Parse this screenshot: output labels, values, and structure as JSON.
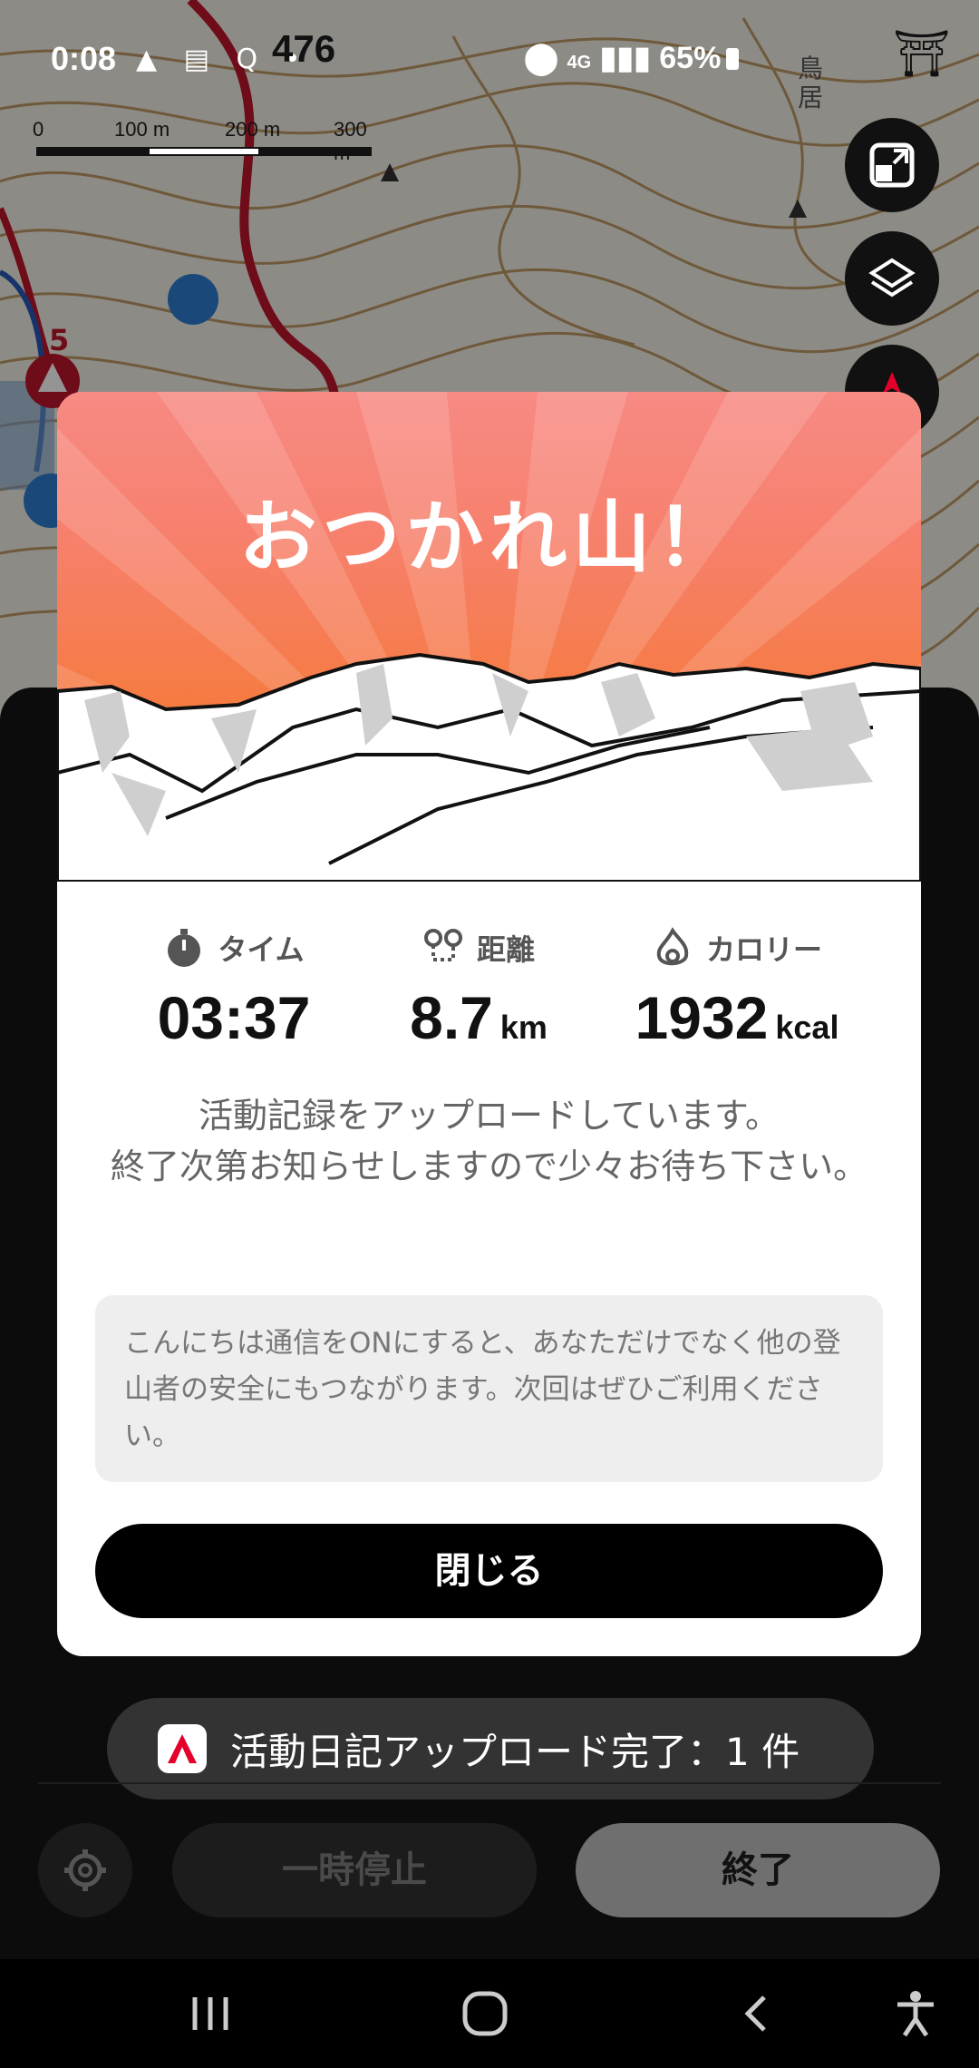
{
  "status_bar": {
    "time": "0:08",
    "left_icons": "▲ ▤ Q •",
    "altitude": "476",
    "right_text": "65%",
    "network": "4G",
    "map_label": "鳥\n居"
  },
  "map": {
    "scale_labels": [
      "0",
      "100 m",
      "200 m",
      "300 m"
    ],
    "trail_marker": "5"
  },
  "modal": {
    "title": "おつかれ山！",
    "stats": [
      {
        "label": "タイム",
        "value": "03:37",
        "unit": "",
        "icon": "stopwatch-icon"
      },
      {
        "label": "距離",
        "value": "8.7",
        "unit": "km",
        "icon": "route-pin-icon"
      },
      {
        "label": "カロリー",
        "value": "1932",
        "unit": "kcal",
        "icon": "flame-icon"
      }
    ],
    "upload_message_line1": "活動記録をアップロードしています。",
    "upload_message_line2": "終了次第お知らせしますので少々お待ち下さい。",
    "notice": "こんにちは通信をONにすると、あなただけでなく他の登山者の安全にもつながります。次回はぜひご利用ください。",
    "close_label": "閉じる"
  },
  "toast": {
    "text": "活動日記アップロード完了：1 件"
  },
  "controls": {
    "pause_label": "一時停止",
    "end_label": "終了"
  },
  "colors": {
    "hero_top": "#f78a84",
    "hero_bottom": "#f06b23",
    "trail_red": "#c0152b",
    "brand_red": "#e4002b"
  }
}
